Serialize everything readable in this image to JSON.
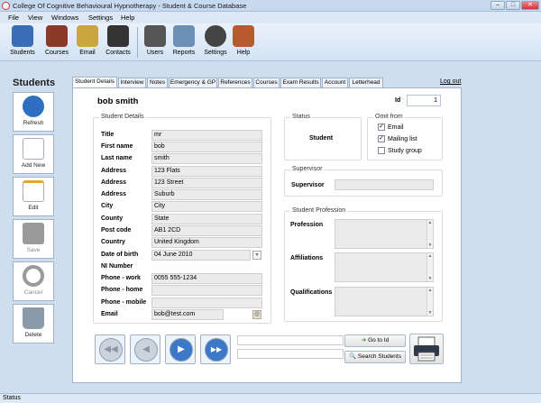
{
  "window": {
    "title": "College Of Cognitive Behavioural Hypnotherapy - Student & Course Database",
    "controls": [
      "–",
      "□",
      "✕"
    ]
  },
  "menu": [
    "File",
    "View",
    "Windows",
    "Settings",
    "Help"
  ],
  "toolbar": [
    {
      "label": "Students",
      "icon": "students-icon",
      "color": "#3a6db5"
    },
    {
      "label": "Courses",
      "icon": "courses-book-icon",
      "color": "#8b3a2a"
    },
    {
      "label": "Email",
      "icon": "email-envelope-icon",
      "color": "#c9a640"
    },
    {
      "label": "Contacts",
      "icon": "contacts-phone-icon",
      "color": "#333333"
    },
    {
      "label": "Users",
      "icon": "users-icon",
      "color": "#555555"
    },
    {
      "label": "Reports",
      "icon": "reports-icon",
      "color": "#6b8fb5"
    },
    {
      "label": "Settings",
      "icon": "settings-gear-icon",
      "color": "#444444"
    },
    {
      "label": "Help",
      "icon": "help-icon",
      "color": "#b85a30"
    }
  ],
  "sidebar": {
    "title": "Students",
    "buttons": [
      {
        "label": "Refresh",
        "icon": "refresh-icon",
        "color": "#2f6fc2",
        "enabled": true
      },
      {
        "label": "Add New",
        "icon": "add-new-document-icon",
        "color": "#dde6f0",
        "enabled": true
      },
      {
        "label": "Edit",
        "icon": "edit-pencil-icon",
        "color": "#e8a530",
        "enabled": true
      },
      {
        "label": "Save",
        "icon": "save-disk-icon",
        "color": "#9a9a9a",
        "enabled": false
      },
      {
        "label": "Cancel",
        "icon": "cancel-icon",
        "color": "#9a9a9a",
        "enabled": false
      },
      {
        "label": "Delete",
        "icon": "delete-trash-icon",
        "color": "#8a9aa8",
        "enabled": true
      }
    ]
  },
  "tabs": [
    "Student Details",
    "Interview",
    "Notes",
    "Emergency & GP",
    "References",
    "Courses",
    "Exam Results",
    "Account",
    "Letterhead"
  ],
  "active_tab": "Student Details",
  "logout": "Log out",
  "student": {
    "name": "bob smith",
    "id_label": "Id",
    "id_value": "1",
    "details_title": "Student Details",
    "fields": [
      {
        "label": "Title",
        "value": "mr"
      },
      {
        "label": "First name",
        "value": "bob"
      },
      {
        "label": "Last name",
        "value": "smith"
      },
      {
        "label": "Address",
        "value": "123 Flats"
      },
      {
        "label": "Address",
        "value": "123 Street"
      },
      {
        "label": "Address",
        "value": "Suburb"
      },
      {
        "label": "City",
        "value": "City"
      },
      {
        "label": "County",
        "value": "State"
      },
      {
        "label": "Post code",
        "value": "AB1 2CD"
      },
      {
        "label": "Country",
        "value": "United Kingdom"
      },
      {
        "label": "Date of birth",
        "value": "04 June 2010"
      },
      {
        "label": "NI Number",
        "value": ""
      },
      {
        "label": "Phone - work",
        "value": "0055 555-1234"
      },
      {
        "label": "Phone - home",
        "value": ""
      },
      {
        "label": "Phone - mobile",
        "value": ""
      },
      {
        "label": "Email",
        "value": "bob@test.com"
      }
    ],
    "status_title": "Status",
    "status_value": "Student",
    "omit_title": "Omit from",
    "omit": [
      {
        "label": "Email",
        "checked": true
      },
      {
        "label": "Mailing list",
        "checked": true
      },
      {
        "label": "Study group",
        "checked": false
      }
    ],
    "supervisor_title": "Supervisor",
    "supervisor_label": "Supervisor",
    "supervisor_value": "",
    "profession_title": "Student Profession",
    "profession_fields": [
      "Profession",
      "Affiliations",
      "Qualifications"
    ]
  },
  "bottom": {
    "goto_label": "Go to Id",
    "search_label": "Search Students",
    "nav_buttons": [
      "first-record-icon",
      "previous-record-icon",
      "next-record-icon",
      "last-record-icon"
    ],
    "print_icon": "printer-icon"
  },
  "status_bar": "Status"
}
